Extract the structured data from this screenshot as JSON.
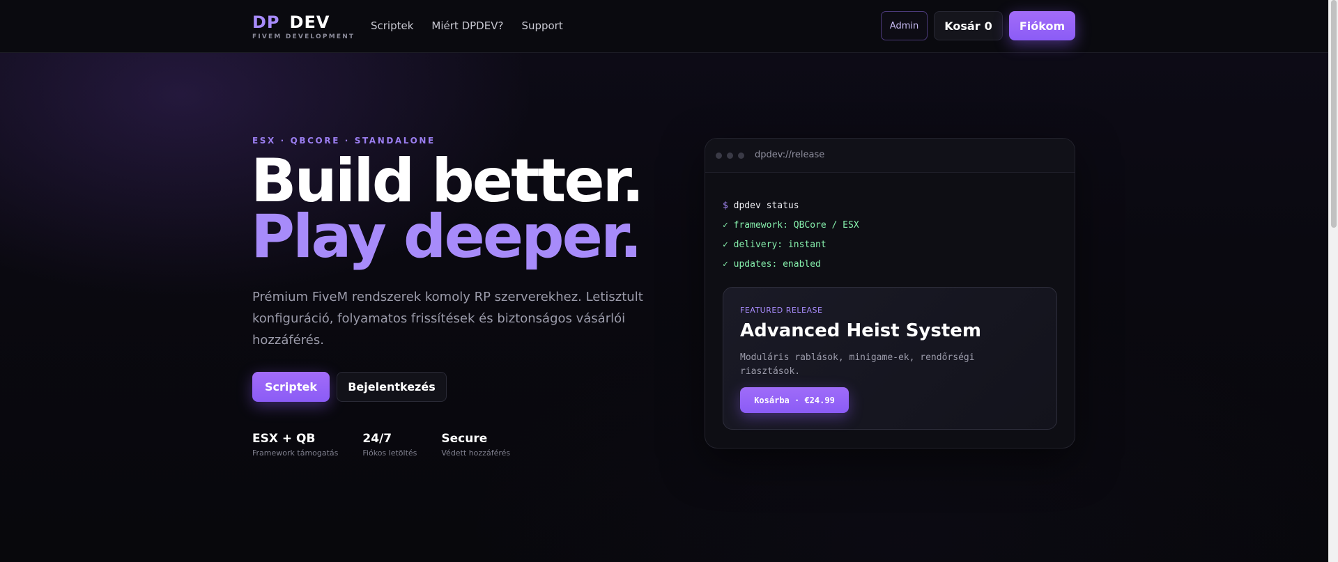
{
  "brand": {
    "logo_dp": "DP",
    "logo_dev": "DEV",
    "tagline": "FIVEM DEVELOPMENT"
  },
  "nav": {
    "links": [
      "Scriptek",
      "Miért DPDEV?",
      "Support"
    ]
  },
  "header_actions": {
    "admin": "Admin",
    "cart_label": "Kosár",
    "cart_count": "0",
    "account": "Fiókom"
  },
  "hero": {
    "eyebrow": "ESX · QBCORE · STANDALONE",
    "title_line1": "Build better.",
    "title_line2": "Play deeper.",
    "description": "Prémium FiveM rendszerek komoly RP szerverekhez. Letisztult konfiguráció, folyamatos frissítések és biztonságos vásárlói hozzáférés.",
    "primary_button": "Scriptek",
    "secondary_button": "Bejelentkezés",
    "stats": [
      {
        "value": "ESX + QB",
        "label": "Framework támogatás"
      },
      {
        "value": "24/7",
        "label": "Fiókos letöltés"
      },
      {
        "value": "Secure",
        "label": "Védett hozzáférés"
      }
    ]
  },
  "terminal": {
    "url": "dpdev://release",
    "prompt": "$",
    "command": "dpdev status",
    "lines": [
      "✓ framework: QBCore / ESX",
      "✓ delivery: instant",
      "✓ updates: enabled"
    ],
    "featured": {
      "tag": "FEATURED RELEASE",
      "title": "Advanced Heist System",
      "description": "Moduláris rablások, minigame-ek, rendőrségi riasztások.",
      "button": "Kosárba · €24.99"
    }
  },
  "colors": {
    "accent": "#8b5cf6",
    "accent_light": "#a78bfa",
    "success": "#86efac",
    "background": "#08080c"
  }
}
